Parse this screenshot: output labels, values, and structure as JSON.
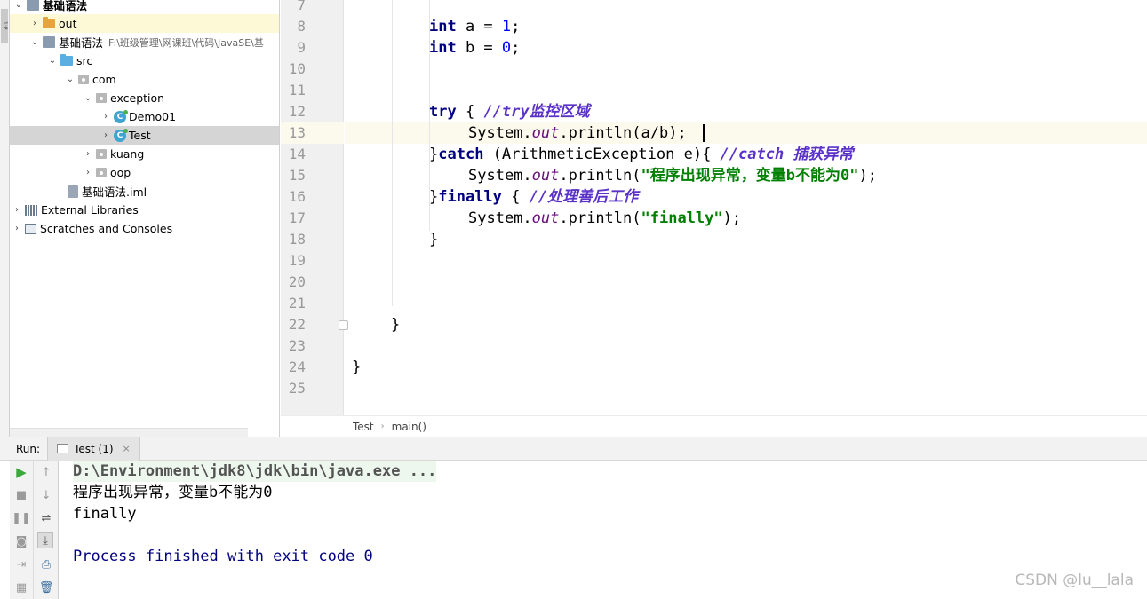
{
  "project_tree": {
    "root_label": "基础语法",
    "items": [
      {
        "label": "out"
      },
      {
        "label": "基础语法",
        "path": "F:\\班级管理\\网课班\\代码\\JavaSE\\基"
      },
      {
        "label": "src"
      },
      {
        "label": "com"
      },
      {
        "label": "exception"
      },
      {
        "label": "Demo01",
        "icon_letter": "C"
      },
      {
        "label": "Test",
        "icon_letter": "C"
      },
      {
        "label": "kuang"
      },
      {
        "label": "oop"
      },
      {
        "label": "基础语法.iml"
      },
      {
        "label": "External Libraries"
      },
      {
        "label": "Scratches and Consoles"
      }
    ]
  },
  "editor": {
    "line_numbers": [
      "7",
      "8",
      "9",
      "10",
      "11",
      "12",
      "13",
      "14",
      "15",
      "16",
      "17",
      "18",
      "19",
      "20",
      "21",
      "22",
      "23",
      "24",
      "25"
    ],
    "code": {
      "l8_kw": "int",
      "l8_rest": " a = ",
      "l8_num": "1",
      "l8_end": ";",
      "l9_kw": "int",
      "l9_rest": " b = ",
      "l9_num": "0",
      "l9_end": ";",
      "l12_kw": "try",
      "l12_rest": " { ",
      "l12_cmt": "//try监控区域",
      "l13_a": "System.",
      "l13_fld": "out",
      "l13_b": ".println(a/b);",
      "l14_a": "}",
      "l14_kw": "catch",
      "l14_b": " (ArithmeticException e){ ",
      "l14_cmt": "//catch 捕获异常",
      "l15_a": "System.",
      "l15_fld": "out",
      "l15_b": ".println(",
      "l15_str": "\"程序出现异常，变量b不能为0\"",
      "l15_c": ");",
      "l16_a": "}",
      "l16_kw": "finally",
      "l16_b": " { ",
      "l16_cmt": "//处理善后工作",
      "l17_a": "System.",
      "l17_fld": "out",
      "l17_b": ".println(",
      "l17_str": "\"finally\"",
      "l17_c": ");",
      "l18": "}",
      "l22": "}",
      "l24": "}"
    },
    "breadcrumb": [
      "Test",
      "main()"
    ],
    "breadcrumb_sep": "›"
  },
  "run_panel": {
    "label": "Run:",
    "tab_label": "Test (1)",
    "tab_close": "×",
    "toolbar_icons": [
      "run-icon",
      "stop-icon",
      "pause-icon",
      "camera-icon",
      "exit-icon",
      "layout-icon",
      "up-icon",
      "down-icon",
      "wrap-icon",
      "scroll-end-icon",
      "print-icon",
      "trash-icon"
    ],
    "console_lines": [
      "D:\\Environment\\jdk8\\jdk\\bin\\java.exe ...",
      "程序出现异常，变量b不能为0",
      "finally",
      "",
      "Process finished with exit code 0"
    ]
  },
  "watermark": "CSDN @lu__lala"
}
